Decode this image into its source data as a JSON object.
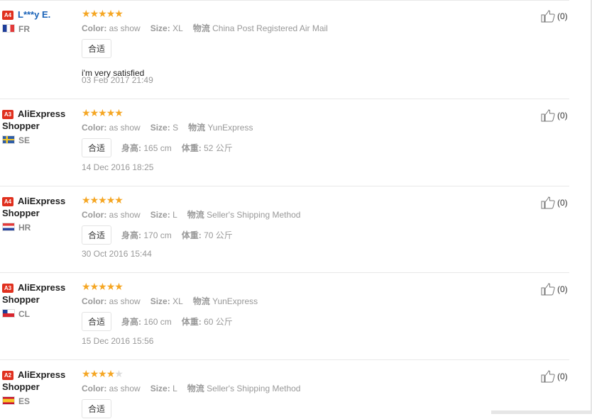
{
  "reviews": [
    {
      "level": "A4",
      "name": "L***y E.",
      "name_is_link": true,
      "country": "FR",
      "flag": "fr",
      "rating": 5,
      "attrs": {
        "color_label": "Color:",
        "color_value": "as show",
        "size_label": "Size:",
        "size_value": "XL",
        "ship_label": "物流",
        "ship_value": "China Post Registered Air Mail"
      },
      "pill": "合适",
      "height_label": "",
      "height_value": "",
      "weight_label": "",
      "weight_value": "",
      "feedback": "i'm very satisfied",
      "date": "03 Feb 2017 21:49",
      "likes": "(0)"
    },
    {
      "level": "A3",
      "name": "AliExpress Shopper",
      "name_is_link": false,
      "country": "SE",
      "flag": "se",
      "rating": 5,
      "attrs": {
        "color_label": "Color:",
        "color_value": "as show",
        "size_label": "Size:",
        "size_value": "S",
        "ship_label": "物流",
        "ship_value": "YunExpress"
      },
      "pill": "合适",
      "height_label": "身高:",
      "height_value": "165 cm",
      "weight_label": "体重:",
      "weight_value": "52 公斤",
      "feedback": "",
      "date": "14 Dec 2016 18:25",
      "likes": "(0)"
    },
    {
      "level": "A4",
      "name": "AliExpress Shopper",
      "name_is_link": false,
      "country": "HR",
      "flag": "hr",
      "rating": 5,
      "attrs": {
        "color_label": "Color:",
        "color_value": "as show",
        "size_label": "Size:",
        "size_value": "L",
        "ship_label": "物流",
        "ship_value": "Seller's Shipping Method"
      },
      "pill": "合适",
      "height_label": "身高:",
      "height_value": "170 cm",
      "weight_label": "体重:",
      "weight_value": "70 公斤",
      "feedback": "",
      "date": "30 Oct 2016 15:44",
      "likes": "(0)"
    },
    {
      "level": "A3",
      "name": "AliExpress Shopper",
      "name_is_link": false,
      "country": "CL",
      "flag": "cl",
      "rating": 5,
      "attrs": {
        "color_label": "Color:",
        "color_value": "as show",
        "size_label": "Size:",
        "size_value": "XL",
        "ship_label": "物流",
        "ship_value": "YunExpress"
      },
      "pill": "合适",
      "height_label": "身高:",
      "height_value": "160 cm",
      "weight_label": "体重:",
      "weight_value": "60 公斤",
      "feedback": "",
      "date": "15 Dec 2016 15:56",
      "likes": "(0)"
    },
    {
      "level": "A2",
      "name": "AliExpress Shopper",
      "name_is_link": false,
      "country": "ES",
      "flag": "es",
      "rating": 4,
      "attrs": {
        "color_label": "Color:",
        "color_value": "as show",
        "size_label": "Size:",
        "size_value": "L",
        "ship_label": "物流",
        "ship_value": "Seller's Shipping Method"
      },
      "pill": "合适",
      "height_label": "",
      "height_value": "",
      "weight_label": "",
      "weight_value": "",
      "feedback": "",
      "date": "",
      "likes": "(0)"
    }
  ],
  "colors": {
    "star_on": "#f5a623",
    "star_off": "#dcdcdc",
    "level_badge": "#e0301e",
    "link": "#1a63b8"
  },
  "icons": {
    "like": "thumbs-up-icon",
    "star": "star-icon"
  }
}
